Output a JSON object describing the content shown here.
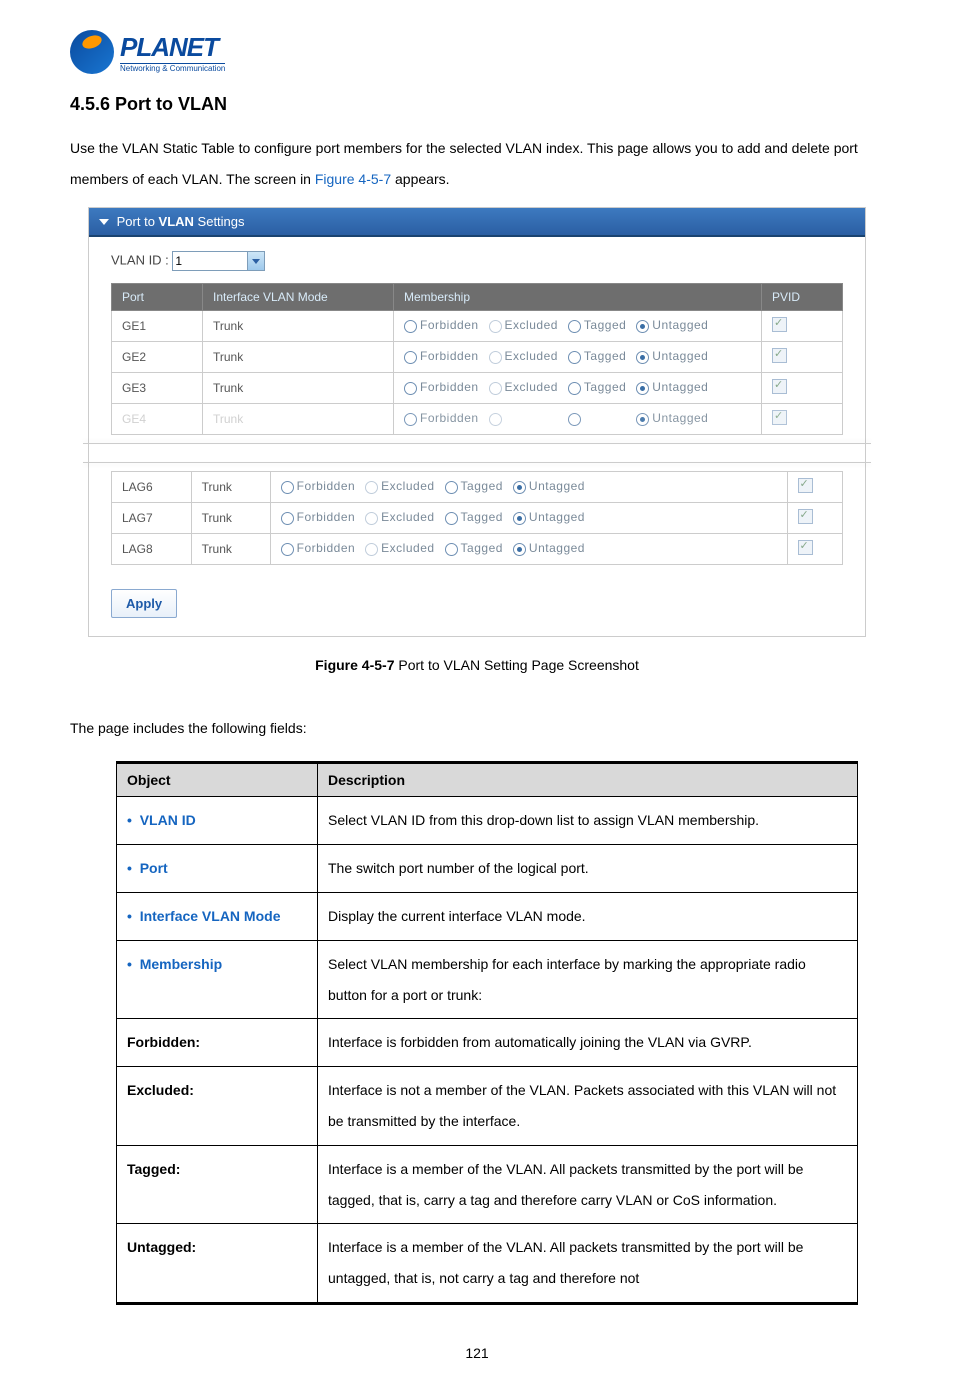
{
  "logo": {
    "name": "PLANET",
    "subtitle": "Networking & Communication"
  },
  "heading": "4.5.6 Port to VLAN",
  "intro_part1": "Use the VLAN Static Table to configure port members for the selected VLAN index. This page allows you to add and delete port members of each VLAN. The screen in ",
  "intro_link": "Figure 4-5-7",
  "intro_part2": " appears.",
  "panel": {
    "title": "Port to VLAN Settings",
    "vlan_id_label": "VLAN ID :",
    "vlan_id_value": "1",
    "headers": {
      "port": "Port",
      "mode": "Interface VLAN Mode",
      "membership": "Membership",
      "pvid": "PVID"
    },
    "radio_labels": {
      "forbidden": "Forbidden",
      "excluded": "Excluded",
      "tagged": "Tagged",
      "untagged": "Untagged"
    },
    "rows_top": [
      {
        "port": "GE1",
        "mode": "Trunk",
        "selected": "untagged"
      },
      {
        "port": "GE2",
        "mode": "Trunk",
        "selected": "untagged"
      },
      {
        "port": "GE3",
        "mode": "Trunk",
        "selected": "untagged"
      },
      {
        "port": "GE4",
        "mode": "Trunk",
        "selected": "untagged",
        "cut": true
      }
    ],
    "rows_bottom": [
      {
        "port": "LAG6",
        "mode": "Trunk",
        "selected": "untagged"
      },
      {
        "port": "LAG7",
        "mode": "Trunk",
        "selected": "untagged"
      },
      {
        "port": "LAG8",
        "mode": "Trunk",
        "selected": "untagged"
      }
    ],
    "apply": "Apply"
  },
  "figure_caption_bold": "Figure 4-5-7",
  "figure_caption_rest": " Port to VLAN Setting Page Screenshot",
  "fields_intro": "The page includes the following fields:",
  "desc_table": {
    "headers": {
      "object": "Object",
      "description": "Description"
    },
    "rows": [
      {
        "obj": "VLAN ID",
        "desc": "Select VLAN ID from this drop-down list to assign VLAN membership."
      },
      {
        "obj": "Port",
        "desc": "The switch port number of the logical port."
      },
      {
        "obj": "Interface VLAN Mode",
        "desc": "Display the current interface VLAN mode."
      }
    ],
    "membership": {
      "obj": "Membership",
      "intro": "Select VLAN membership for each interface by marking the appropriate radio button for a port or trunk:",
      "items": [
        {
          "term": "Forbidden:",
          "desc": "Interface is forbidden from automatically joining the VLAN via GVRP."
        },
        {
          "term": "Excluded:",
          "desc": "Interface is not a member of the VLAN. Packets associated with this VLAN will not be transmitted by the interface."
        },
        {
          "term": "Tagged:",
          "desc": "Interface is a member of the VLAN. All packets transmitted by the port will be tagged, that is, carry a tag and therefore carry VLAN or CoS information."
        },
        {
          "term": "Untagged:",
          "desc": "Interface is a member of the VLAN. All packets transmitted by the port will be untagged, that is, not carry a tag and therefore not"
        }
      ]
    }
  },
  "page_number": "121"
}
